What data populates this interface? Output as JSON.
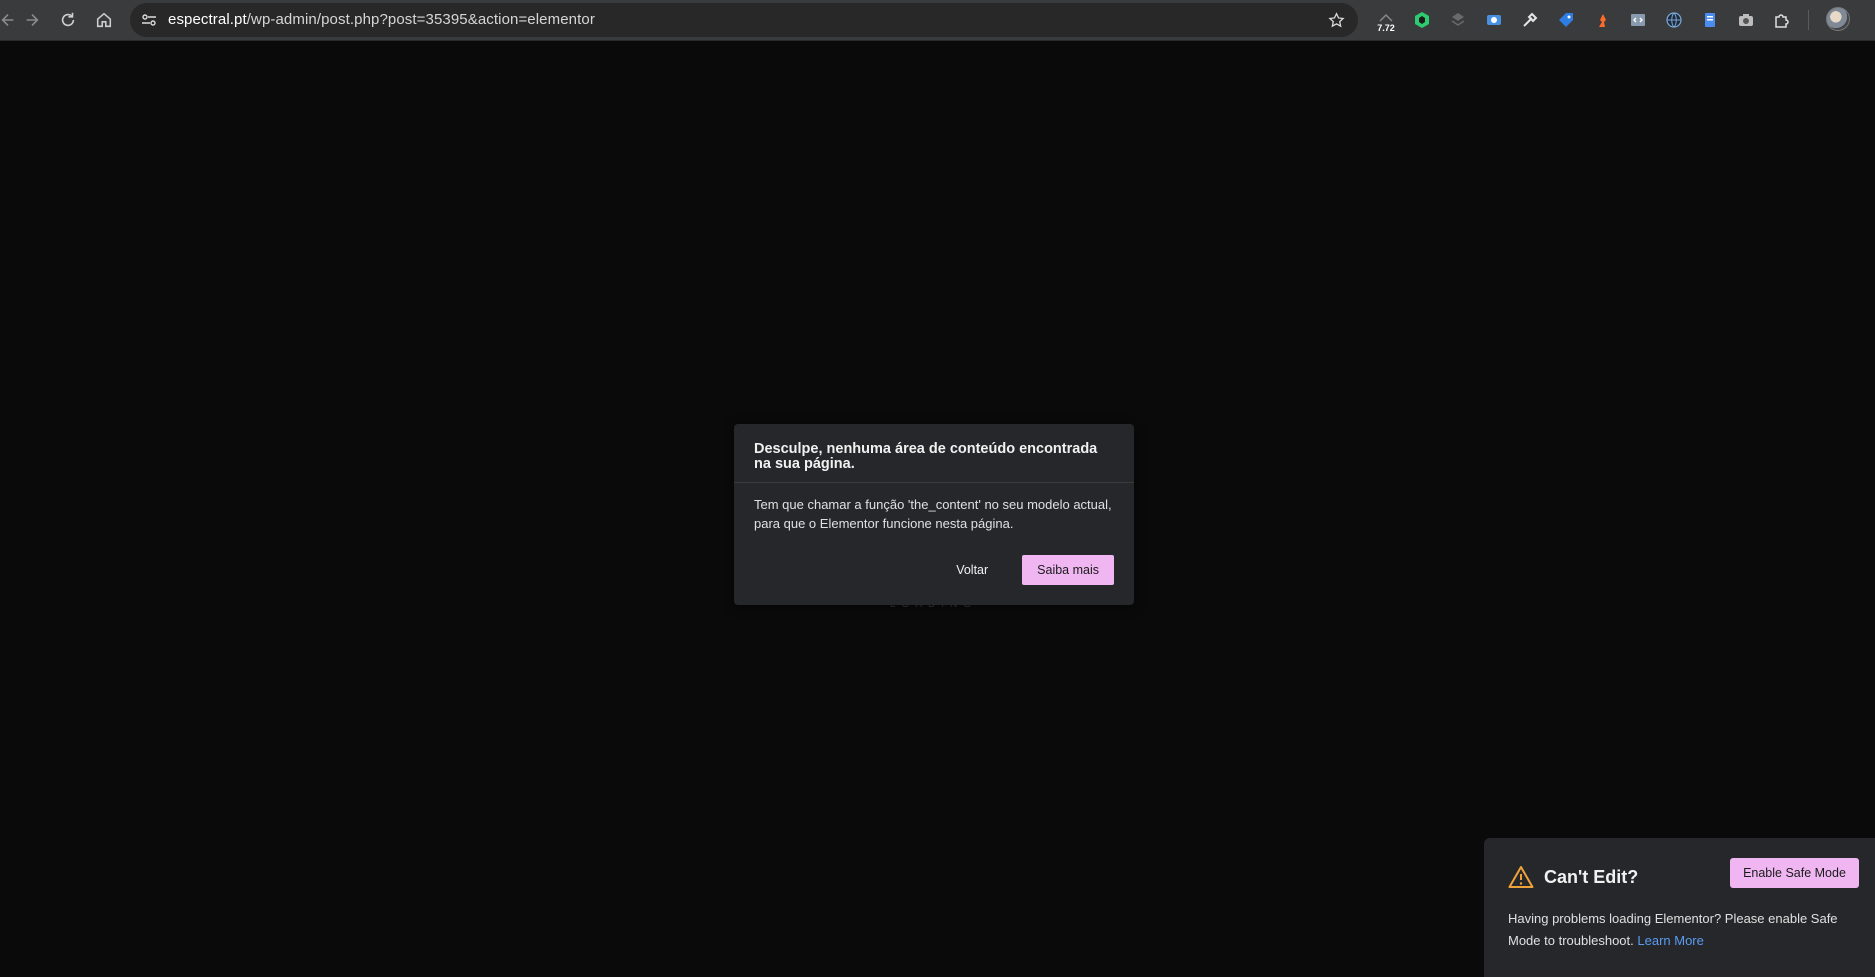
{
  "browser": {
    "url_host": "espectral.pt",
    "url_path": "/wp-admin/post.php?post=35395&action=elementor",
    "extension_badge": "7.72",
    "icons": [
      "back-icon",
      "forward-icon",
      "reload-icon",
      "home-icon",
      "site-info-icon",
      "bookmark-star-icon",
      "extensions-puzzle-icon",
      "profile-avatar"
    ]
  },
  "page": {
    "loading_text": "LOADING"
  },
  "dialog": {
    "title": "Desculpe, nenhuma área de conteúdo encontrada na sua página.",
    "message": "Tem que chamar a função 'the_content' no seu modelo actual, para que o Elementor funcione nesta página.",
    "back_label": "Voltar",
    "learn_label": "Saiba mais"
  },
  "safe_mode": {
    "title": "Can't Edit?",
    "button_label": "Enable Safe Mode",
    "text": "Having problems loading Elementor? Please enable Safe Mode to troubleshoot.",
    "link_label": "Learn More"
  },
  "colors": {
    "background": "#0a0a0a",
    "panel": "#26272b",
    "accent_pink": "#f0b6f2",
    "link_blue": "#5b9cf0",
    "warning_orange": "#f0a23a"
  }
}
